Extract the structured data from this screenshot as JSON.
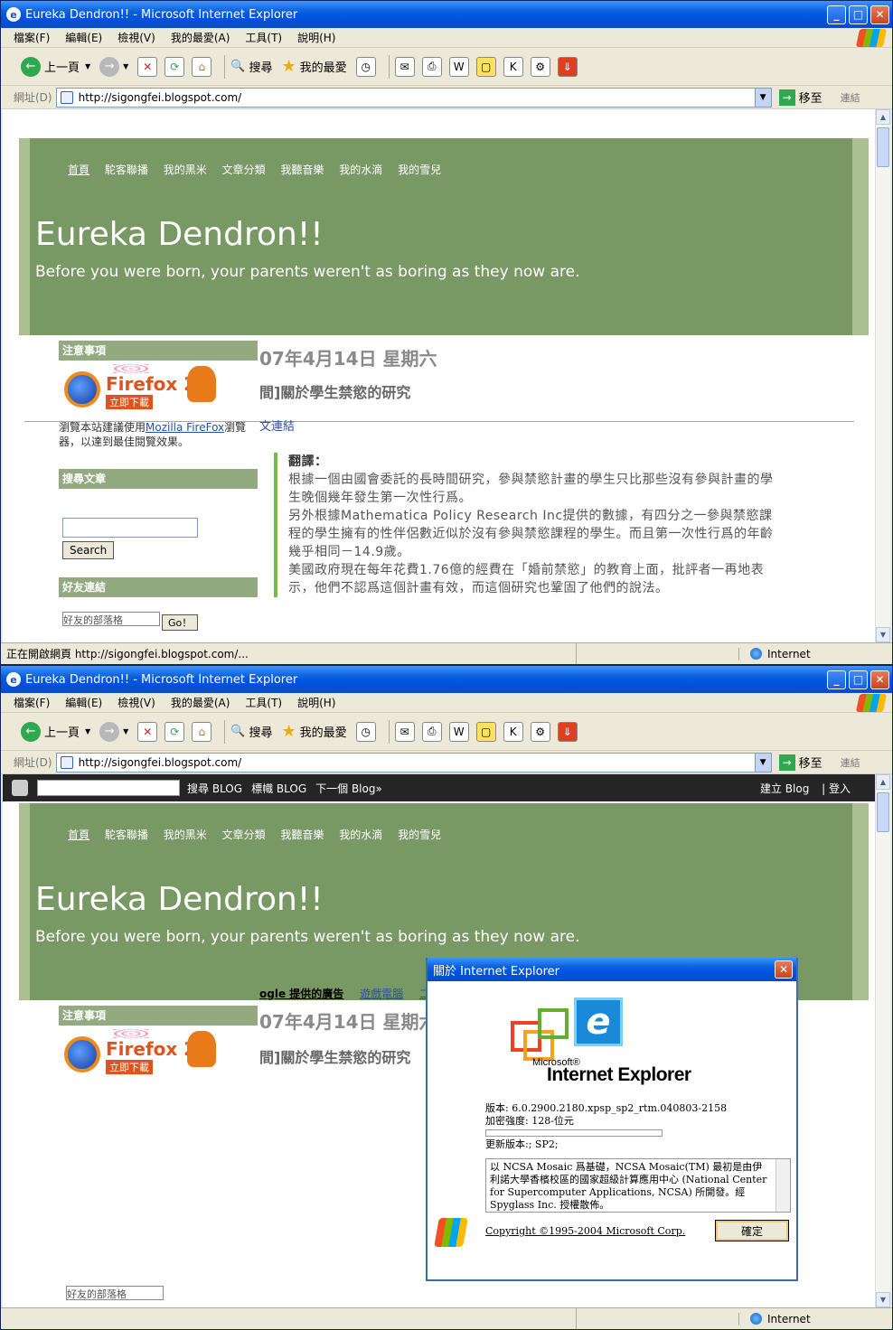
{
  "window": {
    "title": "Eureka Dendron!! - Microsoft Internet Explorer"
  },
  "menu": [
    "檔案(F)",
    "編輯(E)",
    "檢視(V)",
    "我的最愛(A)",
    "工具(T)",
    "說明(H)"
  ],
  "toolbar": {
    "back": "上一頁",
    "search": "搜尋",
    "favorites": "我的最愛"
  },
  "address": {
    "label": "網址(D)",
    "url": "http://sigongfei.blogspot.com/",
    "go": "移至",
    "links": "連結"
  },
  "status": {
    "loading": "正在開啟網頁 http://sigongfei.blogspot.com/...",
    "zone": "Internet"
  },
  "blogger": {
    "search": "搜尋 BLOG",
    "tag": "標幟 BLOG",
    "next": "下一個 Blog»",
    "create": "建立 Blog",
    "login": "登入"
  },
  "blog": {
    "nav": [
      "首頁",
      "駝客聯播",
      "我的黑米",
      "文章分類",
      "我聽音樂",
      "我的水滴",
      "我的雪兒"
    ],
    "title": "Eureka Dendron!!",
    "description": "Before you were born, your parents weren't as boring as they now are.",
    "date": "07年4月14日 星期六",
    "post_title": "間]關於學生禁慾的研究",
    "ads": "ogle 提供的廣告",
    "ad_link": "遊戲電腦",
    "ad_link2": "二",
    "partial_link": "文連結",
    "sidebar": {
      "notice": "注意事項",
      "ff_text": "Firefox 2",
      "ff_sub": "立即下載",
      "note_pre": "瀏覽本站建議使用",
      "note_link": "Mozilla FireFox",
      "note_post": "瀏覽器，以達到最佳閱覽效果。",
      "search_head": "搜尋文章",
      "search_btn": "Search",
      "friends": "好友連結",
      "friends_select": "好友的部落格",
      "go": "Go！"
    },
    "post": {
      "label": "翻譯：",
      "p1": "根據一個由國會委託的長時間研究，參與禁慾計畫的學生只比那些沒有參與計畫的學生晚個幾年發生第一次性行爲。",
      "p2": "另外根據Mathematica Policy Research Inc提供的數據，有四分之一參與禁慾課程的學生擁有的性伴侶數近似於沒有參與禁慾課程的學生。而且第一次性行爲的年齡幾乎相同－14.9歲。",
      "p3": "美國政府現在每年花費1.76億的經費在「婚前禁慾」的教育上面，批評者一再地表示，他們不認爲這個計畫有效，而這個研究也鞏固了他們的說法。"
    }
  },
  "about": {
    "title": "關於 Internet Explorer",
    "ms": "Microsoft®",
    "product": "Internet Explorer",
    "version": "版本: 6.0.2900.2180.xpsp_sp2_rtm.040803-2158",
    "cipher": "加密強度: 128-位元",
    "update": "更新版本:; SP2;",
    "credits": "以 NCSA Mosaic 爲基礎，NCSA Mosaic(TM) 最初是由伊利諾大學香檳校區的國家超級計算應用中心 (National Center for Supercomputer Applications, NCSA) 所開發。經 Spyglass Inc. 授權散佈。",
    "copyright": "Copyright ©1995-2004 Microsoft Corp.",
    "ok": "確定"
  }
}
